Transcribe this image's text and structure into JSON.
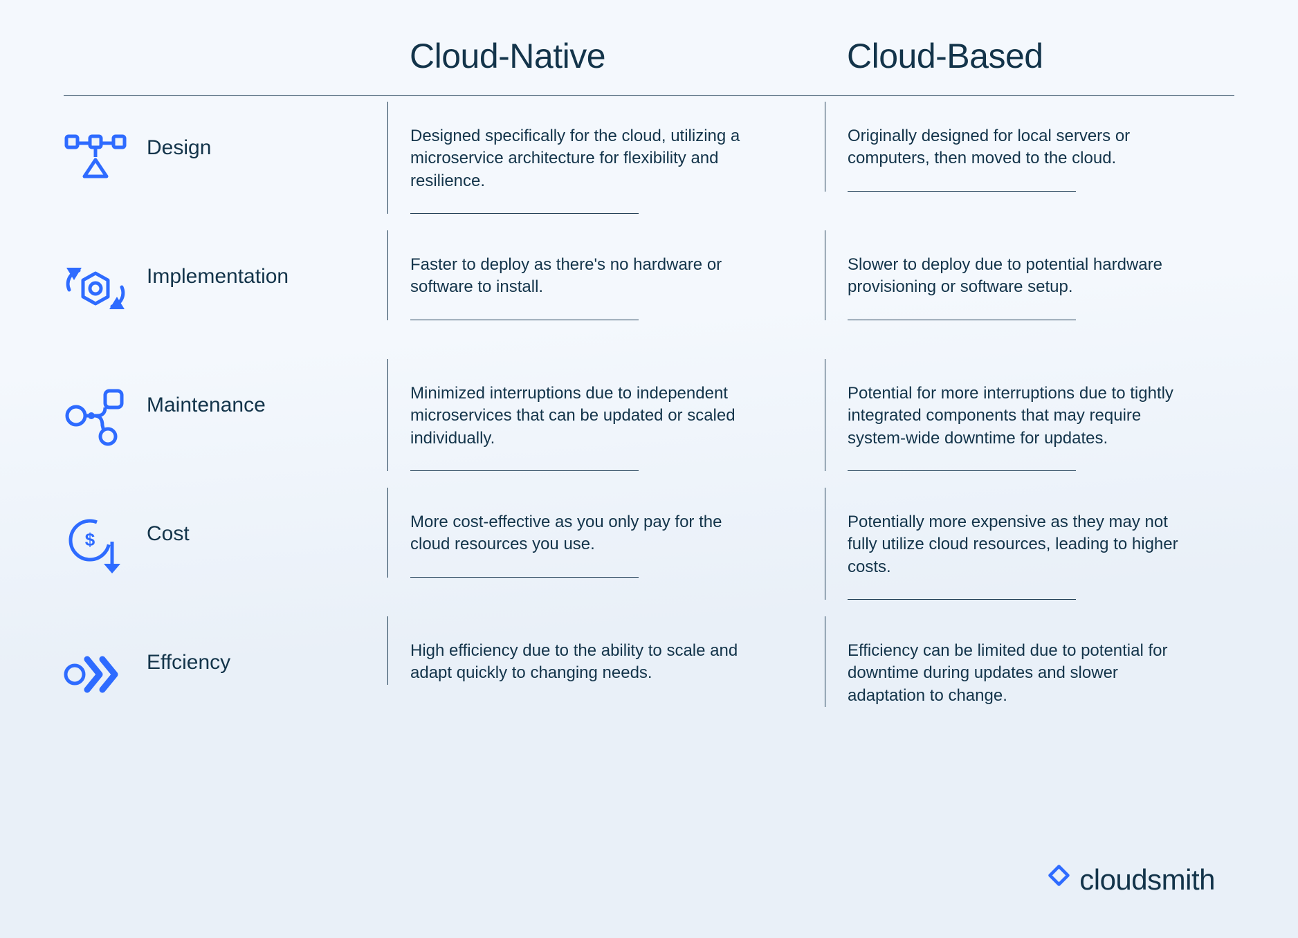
{
  "columns": {
    "native": "Cloud-Native",
    "based": "Cloud-Based"
  },
  "rows": [
    {
      "icon": "microservices-icon",
      "label": "Design",
      "native": "Designed specifically for the cloud, utilizing a microservice architecture for flexibility and resilience.",
      "based": "Originally designed for local servers or computers, then moved to the cloud."
    },
    {
      "icon": "cycle-icon",
      "label": "Implementation",
      "native": "Faster to deploy as there's no hardware or software to install.",
      "based": "Slower to deploy due to potential hardware provisioning or software setup."
    },
    {
      "icon": "nodes-icon",
      "label": "Maintenance",
      "native": "Minimized interruptions due to independent microservices that can be updated or scaled individually.",
      "based": "Potential for more interruptions due to tightly integrated components that may require system-wide downtime for updates."
    },
    {
      "icon": "cost-icon",
      "label": "Cost",
      "native": "More cost-effective as you only pay for the cloud resources you use.",
      "based": "Potentially more expensive as they may not fully utilize cloud resources, leading to higher costs."
    },
    {
      "icon": "efficiency-icon",
      "label": "Effciency",
      "native": "High efficiency due to the ability to scale and adapt quickly to changing needs.",
      "based": "Efficiency can be limited due to potential for downtime during updates and slower adaptation to change."
    }
  ],
  "brand": "cloudsmith"
}
